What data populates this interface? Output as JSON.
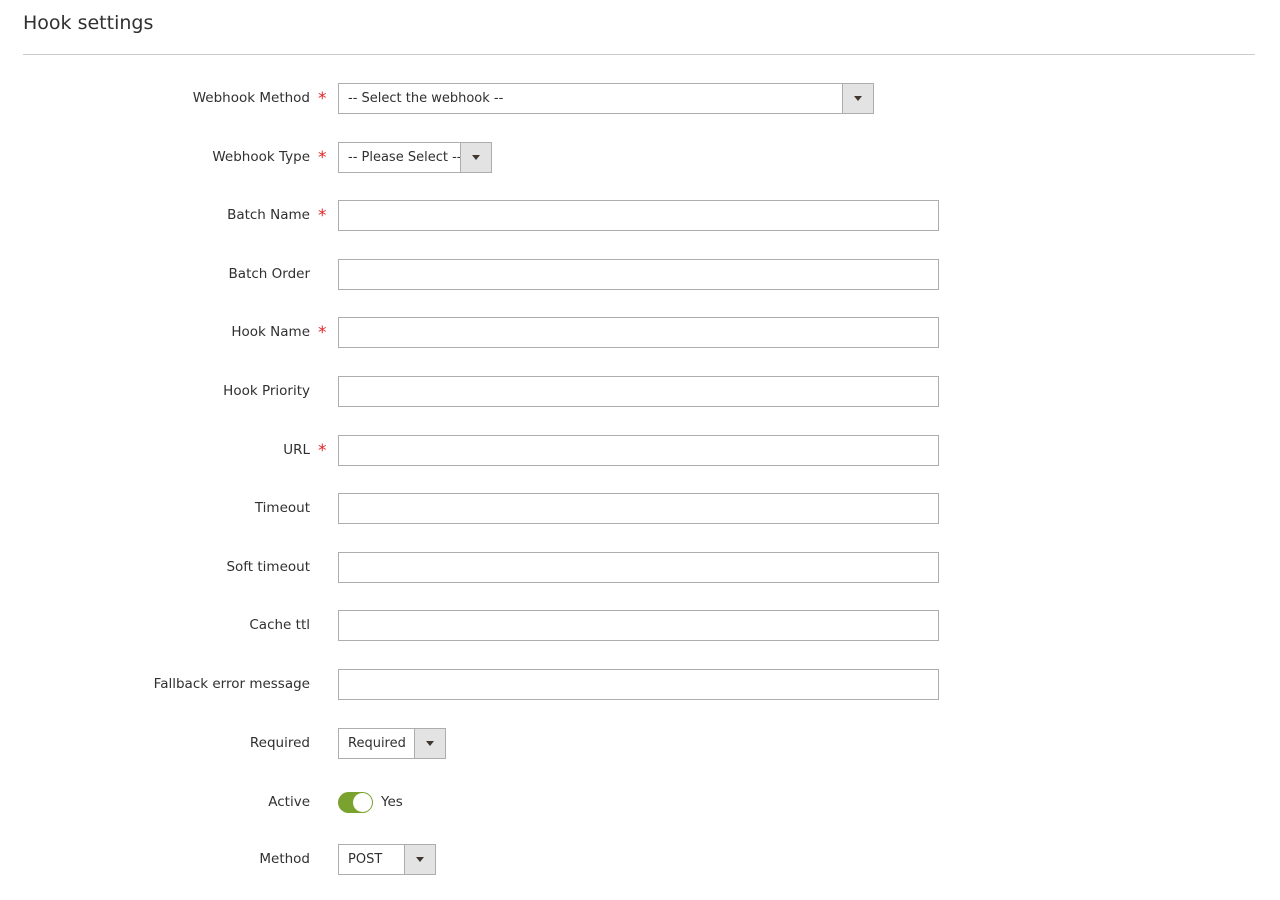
{
  "header": {
    "title": "Hook settings"
  },
  "form": {
    "webhook_method": {
      "label": "Webhook Method",
      "required_mark": "*",
      "value": "-- Select the webhook --"
    },
    "webhook_type": {
      "label": "Webhook Type",
      "required_mark": "*",
      "value": "-- Please Select --"
    },
    "batch_name": {
      "label": "Batch Name",
      "required_mark": "*",
      "value": ""
    },
    "batch_order": {
      "label": "Batch Order",
      "value": ""
    },
    "hook_name": {
      "label": "Hook Name",
      "required_mark": "*",
      "value": ""
    },
    "hook_priority": {
      "label": "Hook Priority",
      "value": ""
    },
    "url": {
      "label": "URL",
      "required_mark": "*",
      "value": ""
    },
    "timeout": {
      "label": "Timeout",
      "value": ""
    },
    "soft_timeout": {
      "label": "Soft timeout",
      "value": ""
    },
    "cache_ttl": {
      "label": "Cache ttl",
      "value": ""
    },
    "fallback_error_message": {
      "label": "Fallback error message",
      "value": ""
    },
    "required": {
      "label": "Required",
      "value": "Required"
    },
    "active": {
      "label": "Active",
      "state_label": "Yes",
      "checked": true
    },
    "method": {
      "label": "Method",
      "value": "POST"
    }
  },
  "colors": {
    "required_star": "#e22626",
    "toggle_on": "#79a22e",
    "divider": "#cccccc",
    "select_button": "#e3e3e3"
  }
}
